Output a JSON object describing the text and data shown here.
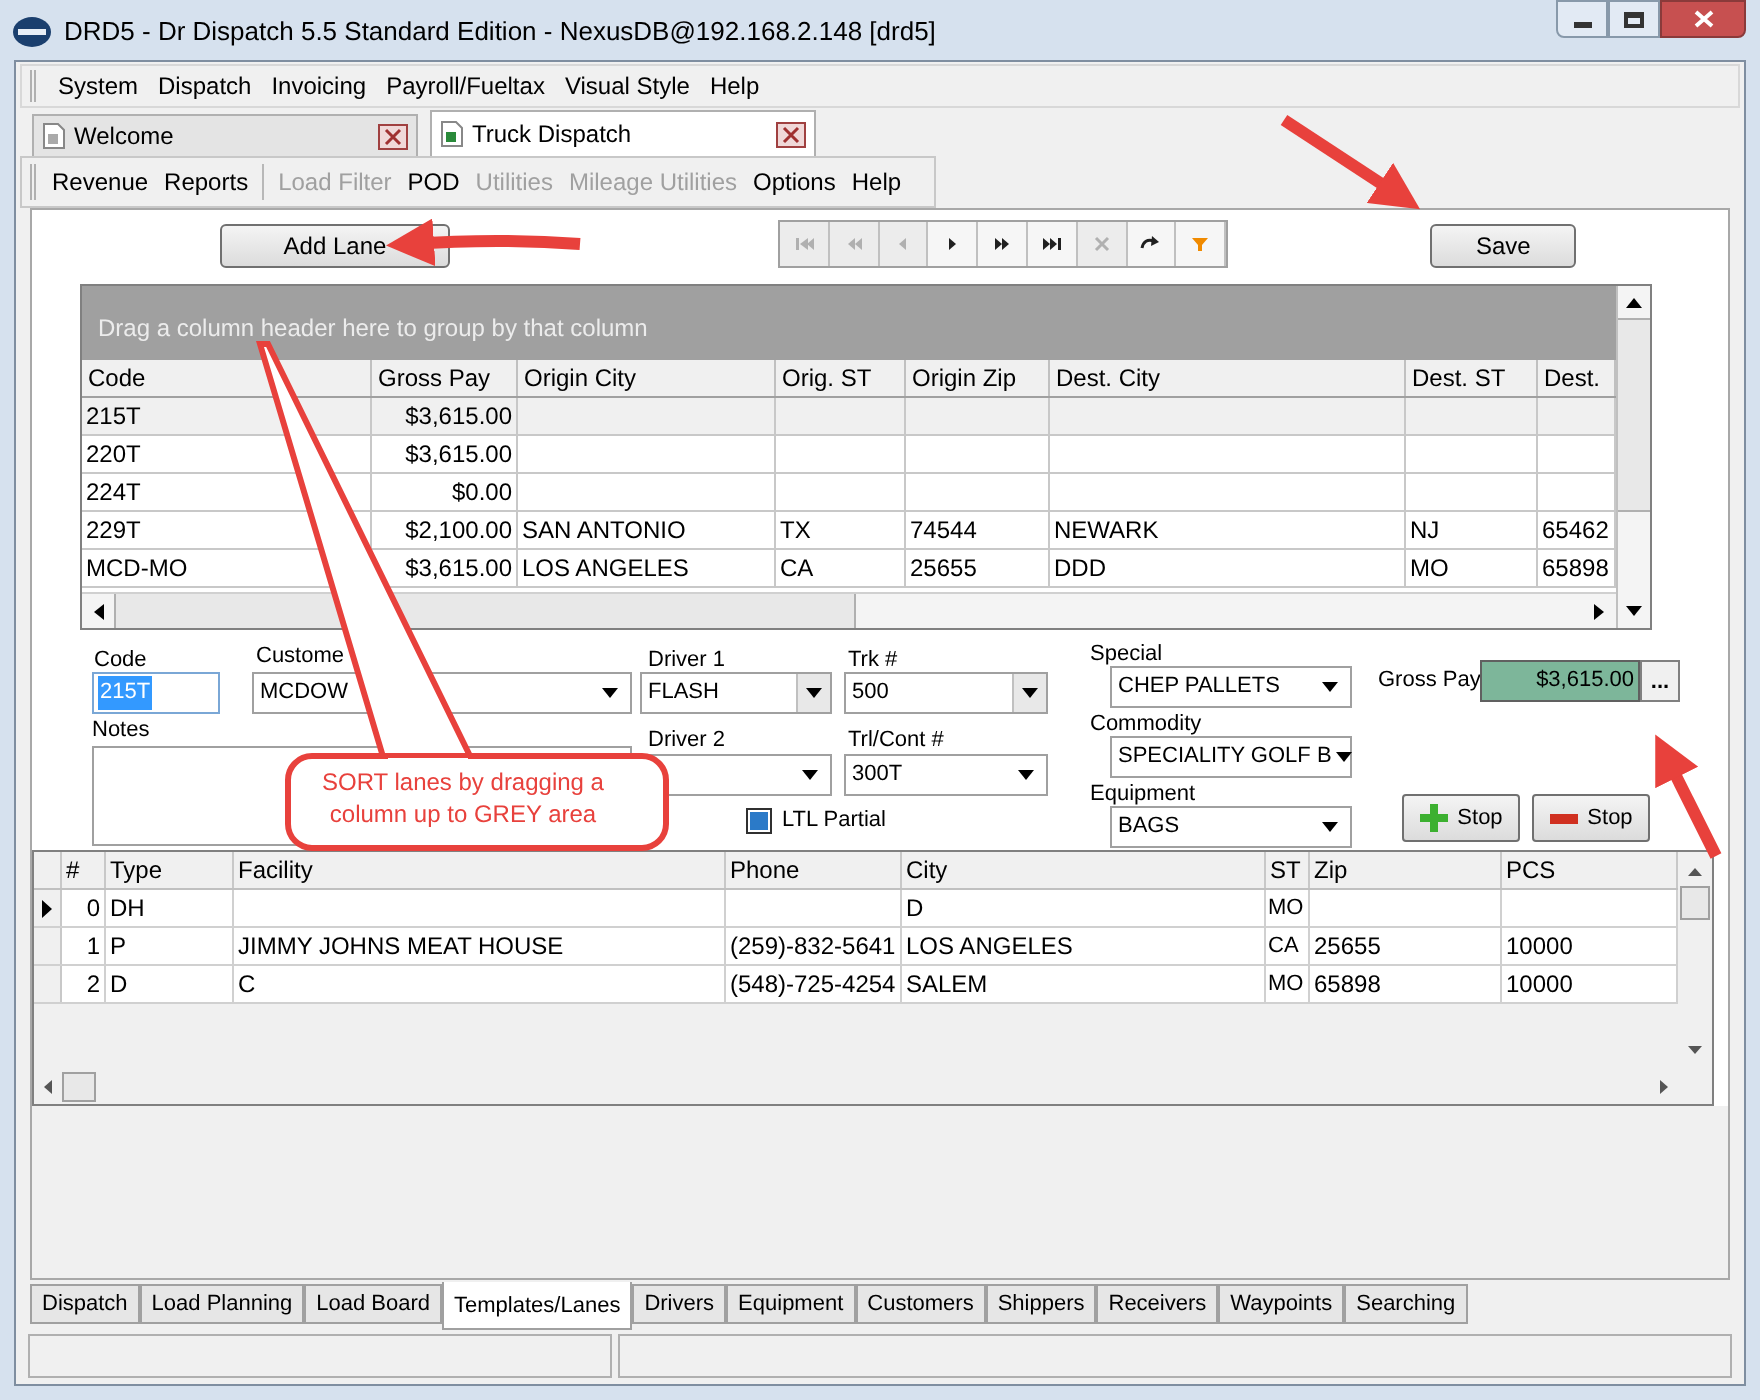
{
  "window": {
    "title": "DRD5 - Dr Dispatch 5.5 Standard Edition - NexusDB@192.168.2.148 [drd5]"
  },
  "menu": [
    "System",
    "Dispatch",
    "Invoicing",
    "Payroll/Fueltax",
    "Visual Style",
    "Help"
  ],
  "doc_tabs": [
    {
      "label": "Welcome",
      "selected": false
    },
    {
      "label": "Truck Dispatch",
      "selected": true
    }
  ],
  "toolbar": [
    {
      "label": "Revenue",
      "disabled": false
    },
    {
      "label": "Reports",
      "disabled": false
    },
    {
      "label": "Load Filter",
      "disabled": true
    },
    {
      "label": "POD",
      "disabled": false
    },
    {
      "label": "Utilities",
      "disabled": true
    },
    {
      "label": "Mileage Utilities",
      "disabled": true
    },
    {
      "label": "Options",
      "disabled": false
    },
    {
      "label": "Help",
      "disabled": false
    }
  ],
  "add_lane_button": "Add Lane",
  "navigator": [
    {
      "kind": "first",
      "disabled": true
    },
    {
      "kind": "prior-page",
      "disabled": true
    },
    {
      "kind": "prior",
      "disabled": true
    },
    {
      "kind": "next",
      "disabled": false
    },
    {
      "kind": "next-page",
      "disabled": false
    },
    {
      "kind": "last",
      "disabled": false
    },
    {
      "kind": "delete",
      "disabled": true
    },
    {
      "kind": "refresh",
      "disabled": false
    },
    {
      "kind": "filter",
      "disabled": false
    }
  ],
  "save_button": "Save",
  "lanes_grid": {
    "group_hint": "Drag a column header here to group by that column",
    "columns": [
      "Code",
      "Gross Pay",
      "Origin City",
      "Orig. ST",
      "Origin Zip",
      "Dest. City",
      "Dest. ST",
      "Dest."
    ],
    "rows": [
      {
        "code": "215T",
        "gross_pay": "$3,615.00",
        "selected": true
      },
      {
        "code": "220T",
        "gross_pay": "$3,615.00",
        "selected": false
      },
      {
        "code": "224T",
        "gross_pay": "$0.00",
        "selected": false
      },
      {
        "code": "229T",
        "gross_pay": "$2,100.00",
        "origin_city": "SAN ANTONIO",
        "orig_st": "TX",
        "origin_zip": "74544",
        "dest_city": "NEWARK",
        "dest_st": "NJ",
        "dest_zip": "65462",
        "selected": false
      },
      {
        "code": "MCD-MO",
        "gross_pay": "$3,615.00",
        "origin_city": "LOS ANGELES",
        "orig_st": "CA",
        "origin_zip": "25655",
        "dest_city": "DDD",
        "dest_st": "MO",
        "dest_zip": "65898",
        "selected": false
      }
    ]
  },
  "lane_form": {
    "code": {
      "label": "Code",
      "value": "215T"
    },
    "customer": {
      "label": "Custome",
      "value": "MCDOW"
    },
    "notes": {
      "label": "Notes"
    },
    "driver_1": {
      "label": "Driver 1",
      "value": "FLASH"
    },
    "driver_2": {
      "label": "Driver 2"
    },
    "truck": {
      "label": "Trk #",
      "value": "500"
    },
    "trailer": {
      "label": "Trl/Cont #",
      "value": "300T"
    },
    "ltl_partial": {
      "label": "LTL Partial",
      "checked": true
    },
    "special": {
      "label": "Special",
      "value": "CHEP PALLETS"
    },
    "commodity": {
      "label": "Commodity",
      "value": "SPECIALITY GOLF B"
    },
    "equipment": {
      "label": "Equipment",
      "value": "BAGS"
    },
    "gross_pay": {
      "label": "Gross Pay",
      "value": "$3,615.00"
    },
    "more_button": "...",
    "add_stop_button": "Stop",
    "remove_stop_button": "Stop"
  },
  "stops_grid": {
    "columns": [
      "#",
      "Type",
      "Facility",
      "Phone",
      "City",
      "ST",
      "Zip",
      "PCS"
    ],
    "rows": [
      {
        "num": "0",
        "type": "DH",
        "city": "D",
        "st": "MO",
        "current": true
      },
      {
        "num": "1",
        "type": "P",
        "facility": "JIMMY JOHNS MEAT HOUSE",
        "phone": "(259)-832-5641",
        "city": "LOS ANGELES",
        "st": "CA",
        "zip": "25655",
        "pcs": "10000",
        "current": false
      },
      {
        "num": "2",
        "type": "D",
        "facility": "C",
        "phone": "(548)-725-4254",
        "city": "SALEM",
        "st": "MO",
        "zip": "65898",
        "pcs": "10000",
        "current": false
      }
    ]
  },
  "bottom_tabs": [
    {
      "label": "Dispatch",
      "selected": false
    },
    {
      "label": "Load Planning",
      "selected": false
    },
    {
      "label": "Load Board",
      "selected": false
    },
    {
      "label": "Templates/Lanes",
      "selected": true
    },
    {
      "label": "Drivers",
      "selected": false
    },
    {
      "label": "Equipment",
      "selected": false
    },
    {
      "label": "Customers",
      "selected": false
    },
    {
      "label": "Shippers",
      "selected": false
    },
    {
      "label": "Receivers",
      "selected": false
    },
    {
      "label": "Waypoints",
      "selected": false
    },
    {
      "label": "Searching",
      "selected": false
    }
  ],
  "annotation": {
    "callout": "SORT lanes by dragging a column up to GREY area"
  }
}
